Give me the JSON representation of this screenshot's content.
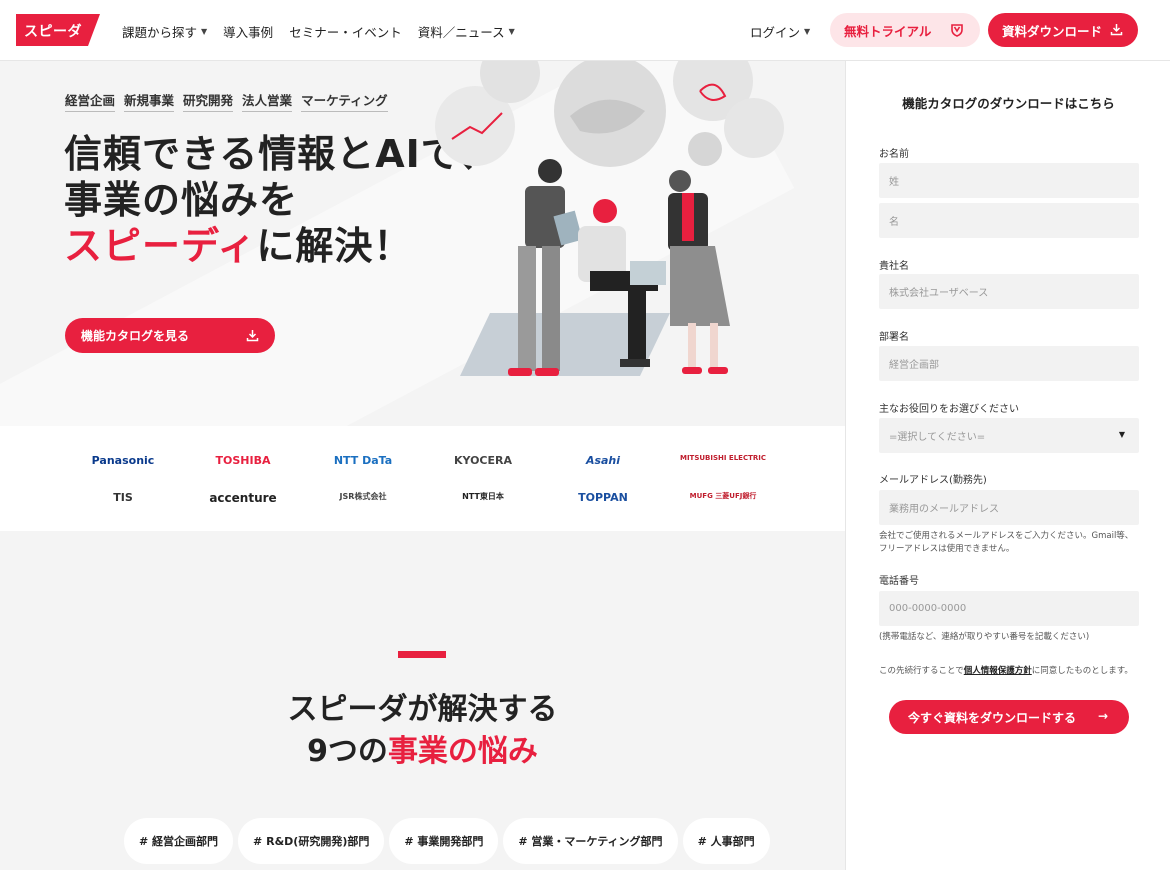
{
  "header": {
    "logo": "スピーダ",
    "nav": [
      {
        "label": "課題から探す",
        "has_caret": true
      },
      {
        "label": "導入事例",
        "has_caret": false
      },
      {
        "label": "セミナー・イベント",
        "has_caret": false
      },
      {
        "label": "資料／ニュース",
        "has_caret": true
      }
    ],
    "login": "ログイン",
    "trial": "無料トライアル",
    "download": "資料ダウンロード"
  },
  "hero": {
    "tags": [
      "経営企画",
      "新規事業",
      "研究開発",
      "法人営業",
      "マーケティング"
    ],
    "line1": "信頼できる情報とAIで、",
    "line2": "事業の悩みを",
    "line3_accent": "スピーディ",
    "line3_rest": "に解決！",
    "cta": "機能カタログを見る"
  },
  "logos": [
    "Panasonic",
    "TOSHIBA",
    "NTT DaTa",
    "KYOCERA",
    "Asahi",
    "MITSUBISHI ELECTRIC",
    "TIS",
    "accenture",
    "JSR株式会社",
    "NTT東日本",
    "TOPPAN",
    "MUFG 三菱UFJ銀行"
  ],
  "section": {
    "title_line1": "スピーダが解決する",
    "title_line2_pre": "9つの",
    "title_line2_accent": "事業の悩み",
    "chips": [
      "# 経営企画部門",
      "# R&D(研究開発)部門",
      "# 事業開発部門",
      "# 営業・マーケティング部門",
      "# 人事部門"
    ]
  },
  "form": {
    "title": "機能カタログのダウンロードはこちら",
    "name_label": "お名前",
    "last_name_placeholder": "姓",
    "first_name_placeholder": "名",
    "company_label": "貴社名",
    "company_placeholder": "株式会社ユーザベース",
    "dept_label": "部署名",
    "dept_placeholder": "経営企画部",
    "role_label": "主なお役回りをお選びください",
    "role_value": "=選択してください=",
    "email_label": "メールアドレス(勤務先)",
    "email_placeholder": "業務用のメールアドレス",
    "email_note": "会社でご使用されるメールアドレスをご入力ください。Gmail等、フリーアドレスは使用できません。",
    "phone_label": "電話番号",
    "phone_placeholder": "000-0000-0000",
    "phone_note": "(携帯電話など、連絡が取りやすい番号を記載ください)",
    "consent_pre": "この先続行することで",
    "consent_link": "個人情報保護方針",
    "consent_post": "に同意したものとします。",
    "submit": "今すぐ資料をダウンロードする"
  },
  "colors": {
    "accent": "#e8203f",
    "accent_light": "#fde5e8",
    "bg_gray": "#f4f4f4"
  }
}
